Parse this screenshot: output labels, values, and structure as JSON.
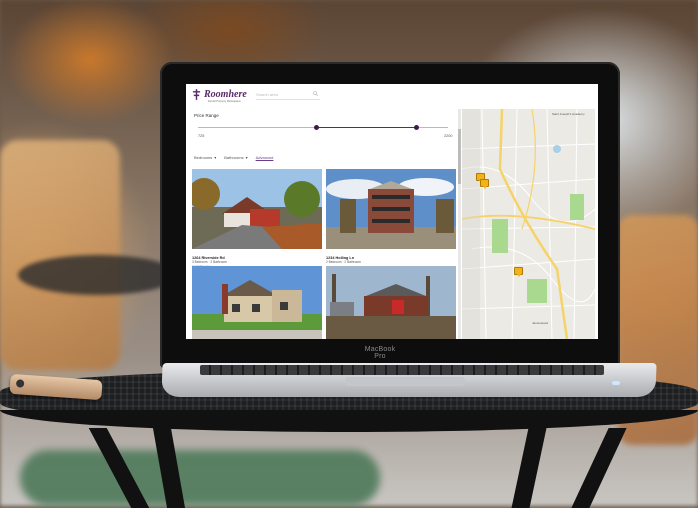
{
  "laptop": {
    "brand_label": "MacBook Pro"
  },
  "app": {
    "logo_text": "Roomhere",
    "tagline": "Rental Property Marketplace",
    "search_placeholder": "Search area"
  },
  "price_filter": {
    "label": "Price Range",
    "min_label": "725",
    "max_label": "2200",
    "range_fraction": [
      0.47,
      0.87
    ]
  },
  "filters": [
    {
      "label": "Bedrooms",
      "icon": "chevron-down-icon"
    },
    {
      "label": "Bathrooms",
      "icon": "chevron-down-icon"
    },
    {
      "label": "Advanced",
      "icon": ""
    }
  ],
  "listings": [
    {
      "address": "1264 Riverside Rd",
      "meta": "3 Bedroom · 2 Bathroom",
      "status": "Available now"
    },
    {
      "address": "1234 Holling Ln",
      "meta": "2 Bedroom · 2 Bathroom",
      "status": ""
    },
    {
      "address": "",
      "meta": "",
      "status": ""
    },
    {
      "address": "",
      "meta": "",
      "status": ""
    }
  ],
  "map": {
    "labels": [
      "Saint Joseph's Academy",
      "Jameswood"
    ],
    "pin_icon": "map-pin-icon",
    "colors": {
      "road_major": "#f5d36a",
      "park": "#a9d98f",
      "water": "#a8cfe8",
      "pin": "#f2b21b"
    }
  },
  "colors": {
    "brand": "#5a2a6a",
    "accent": "#3f1a50"
  }
}
